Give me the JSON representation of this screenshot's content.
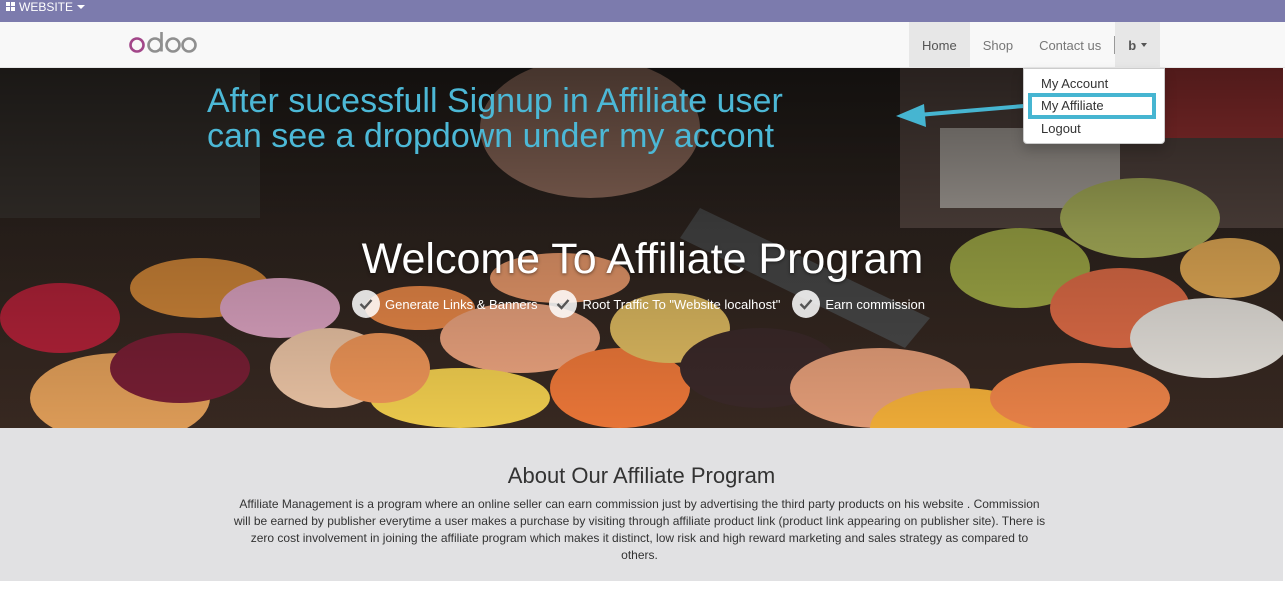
{
  "admin_bar": {
    "menu_label": "WEBSITE",
    "color": "#7c7bad"
  },
  "logo": {
    "text": "odoo"
  },
  "nav": {
    "items": [
      {
        "label": "Home",
        "active": true
      },
      {
        "label": "Shop"
      },
      {
        "label": "Contact us"
      }
    ],
    "user_label": "b"
  },
  "dropdown": {
    "items": [
      "My Account",
      "My Affiliate",
      "Logout"
    ],
    "highlighted": "My Affiliate",
    "highlight_color": "#46b5d1"
  },
  "annotation": {
    "line1": "After sucessfull Signup in Affiliate user",
    "line2": "can see a dropdown under my accont",
    "color": "#4cb8d6"
  },
  "hero": {
    "title": "Welcome To Affiliate Program",
    "features": [
      "Generate Links & Banners",
      "Root Traffic To \"Website localhost\"",
      "Earn commission"
    ]
  },
  "about": {
    "title": "About Our Affiliate Program",
    "text": "Affiliate Management is a program where an online seller can earn commission just by advertising the third party products on his website . Commission will be earned by publisher everytime a user makes a purchase by visiting through affiliate product link (product link appearing on publisher site). There is zero cost involvement in joining the affiliate program which makes it distinct, low risk and high reward marketing and sales strategy as compared to others."
  }
}
